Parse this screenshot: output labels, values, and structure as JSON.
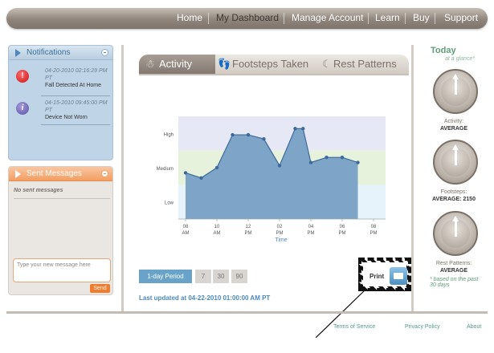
{
  "nav": {
    "items": [
      "Home",
      "My Dashboard",
      "Manage Account",
      "Learn",
      "Buy",
      "Support"
    ]
  },
  "notifications": {
    "title": "Notifications",
    "items": [
      {
        "date": "04-20-2010 02:16:29 PM PT",
        "text": "Fall Detected At Home",
        "icon": "alert-icon",
        "icon_glyph": "!"
      },
      {
        "date": "04-15-2010 09:45:00 PM PT",
        "text": "Device Not Worn",
        "icon": "info-icon",
        "icon_glyph": "i"
      }
    ]
  },
  "sent_messages": {
    "title": "Sent Messages",
    "empty_text": "No sent messages",
    "input_placeholder": "Type your new message here",
    "send_label": "Send"
  },
  "tabs": [
    {
      "label": "Activity",
      "icon": "activity-icon",
      "glyph": "☃"
    },
    {
      "label": "Footsteps Taken",
      "icon": "footsteps-icon",
      "glyph": "👣"
    },
    {
      "label": "Rest Patterns",
      "icon": "moon-icon",
      "glyph": "☾"
    }
  ],
  "chart_data": {
    "type": "area",
    "xlabel": "Time",
    "x_ticks": [
      "08 AM",
      "10 AM",
      "12 PM",
      "02 PM",
      "04 PM",
      "06 PM",
      "08 PM"
    ],
    "y_categories": [
      "Low",
      "Medium",
      "High"
    ],
    "x": [
      "08 AM",
      "09 AM",
      "10 AM",
      "11 AM",
      "12 PM",
      "01 PM",
      "02 PM",
      "03 PM",
      "03:30 PM",
      "04 PM",
      "05 PM",
      "06 PM",
      "07 PM"
    ],
    "values": [
      0.45,
      0.4,
      0.5,
      0.82,
      0.82,
      0.78,
      0.52,
      0.88,
      0.88,
      0.55,
      0.6,
      0.6,
      0.55
    ],
    "bands": {
      "low_color": "#e6f3fa",
      "medium_color": "#e6f2dc",
      "high_color": "#e6e8f6"
    },
    "area_color": "#7ea4c8",
    "line_color": "#3d6a9b"
  },
  "period": {
    "main_label": "1-day Period",
    "options": [
      "7",
      "30",
      "90"
    ]
  },
  "print_label": "Print",
  "last_updated": "Last updated at 04-22-2010 01:00:00 AM PT",
  "today": {
    "title": "Today",
    "subtitle": "at a glance*",
    "gauges": [
      {
        "label": "Activity:",
        "value": "AVERAGE"
      },
      {
        "label": "Footsteps:",
        "value": "AVERAGE: 2150"
      },
      {
        "label": "Rest Patterns:",
        "value": "AVERAGE"
      }
    ],
    "footnote": "* based on the past 30 days"
  },
  "footer": [
    "Terms of Service",
    "Privacy Policy",
    "About"
  ]
}
